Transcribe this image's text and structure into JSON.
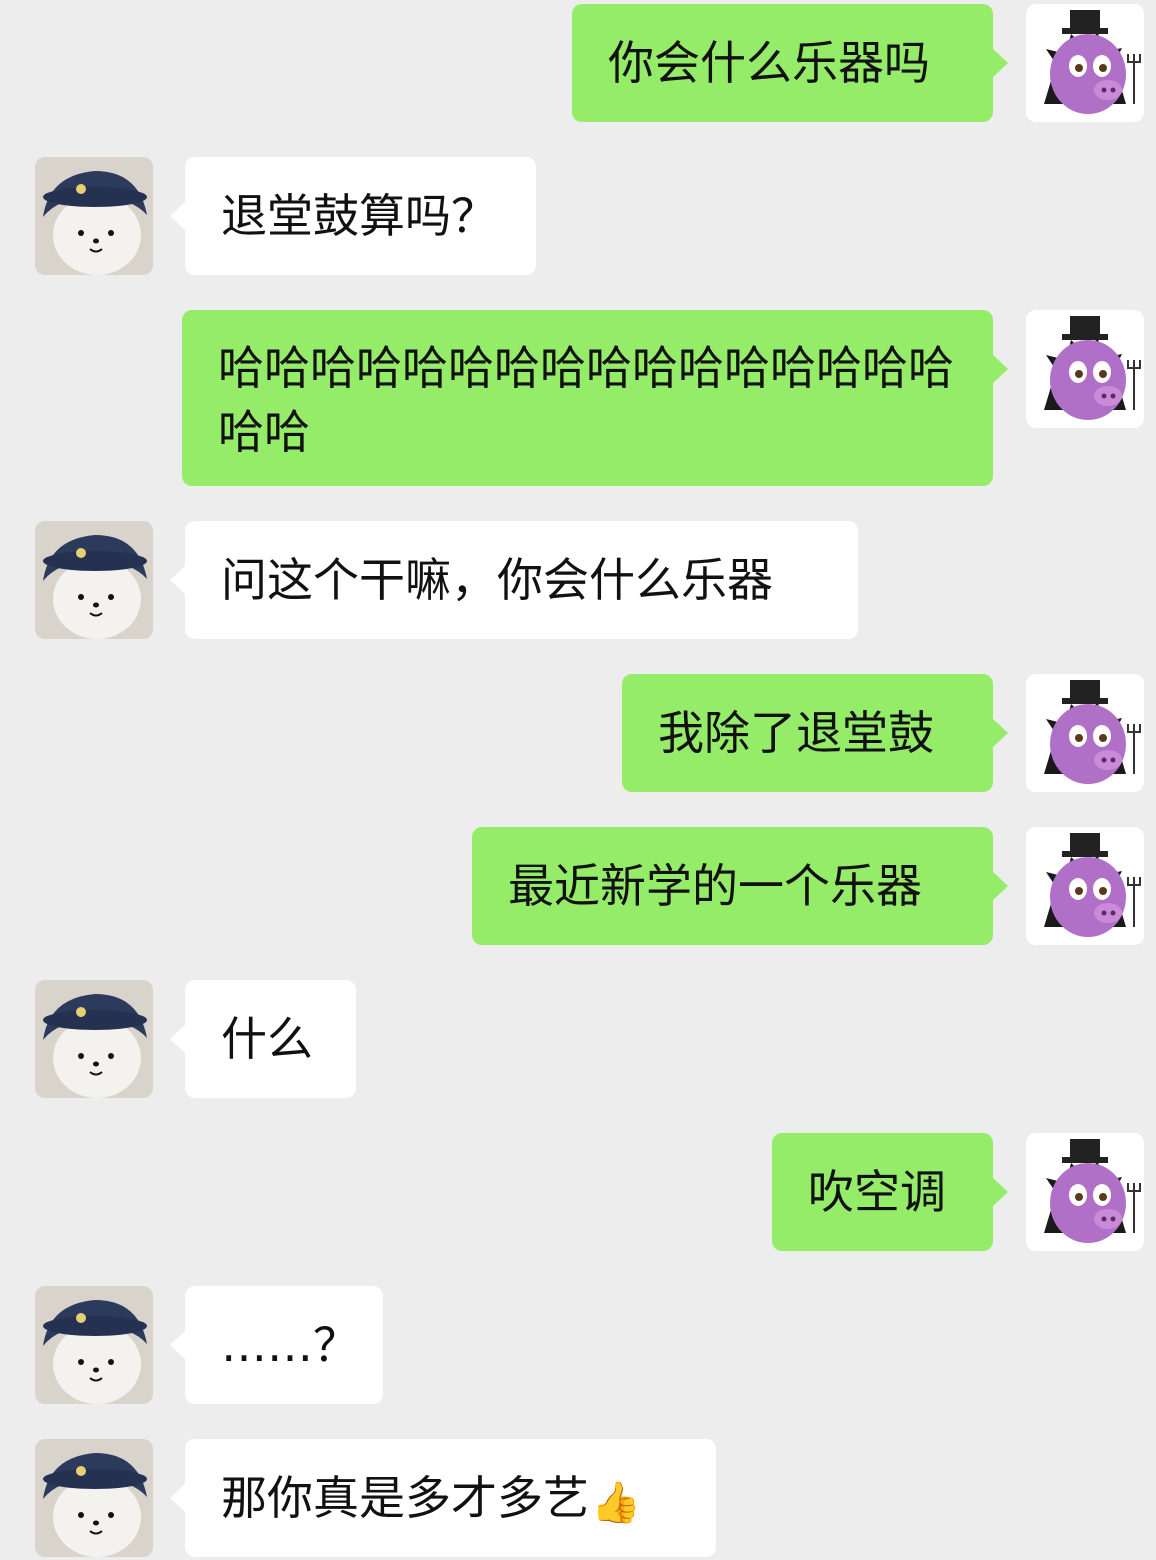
{
  "chat": {
    "avatars": {
      "self": "purple-pig-devil-avatar",
      "other": "bear-with-hat-avatar"
    },
    "colors": {
      "background": "#ededed",
      "self_bubble": "#95ec69",
      "other_bubble": "#ffffff"
    },
    "messages": [
      {
        "sender": "self",
        "text": "你会什么乐器吗"
      },
      {
        "sender": "other",
        "text": "退堂鼓算吗？"
      },
      {
        "sender": "self",
        "text": "哈哈哈哈哈哈哈哈哈哈哈哈哈哈哈哈哈哈"
      },
      {
        "sender": "other",
        "text": "问这个干嘛，你会什么乐器"
      },
      {
        "sender": "self",
        "text": "我除了退堂鼓"
      },
      {
        "sender": "self",
        "text": "最近新学的一个乐器"
      },
      {
        "sender": "other",
        "text": "什么"
      },
      {
        "sender": "self",
        "text": "吹空调"
      },
      {
        "sender": "other",
        "text": "……？"
      },
      {
        "sender": "other",
        "text": "那你真是多才多艺",
        "emoji": "👍"
      }
    ]
  }
}
